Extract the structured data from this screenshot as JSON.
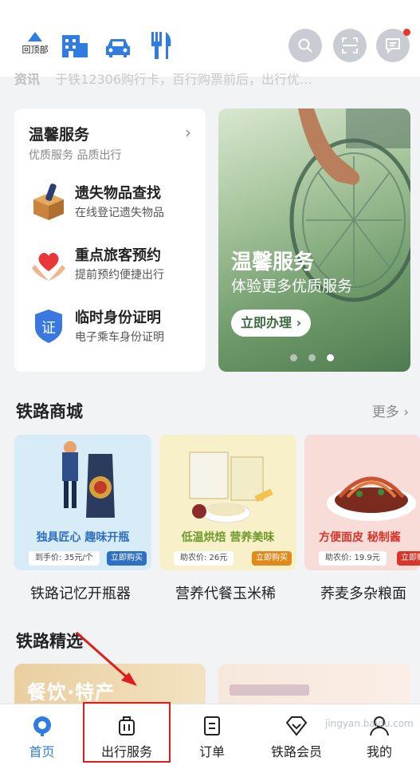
{
  "topbar": {
    "back_to_top": "回顶部",
    "icons": [
      "building-icon",
      "car-icon",
      "fork-knife-icon",
      "search-icon",
      "scan-icon",
      "message-icon"
    ],
    "accent": "#2f7de1"
  },
  "news": {
    "label": "资讯",
    "text": "于铁12306购行卡，百行购票前后，出行优…"
  },
  "warm_service": {
    "title": "温馨服务",
    "subtitle": "优质服务 品质出行",
    "items": [
      {
        "title": "遗失物品查找",
        "desc": "在线登记遗失物品",
        "icon": "box-icon"
      },
      {
        "title": "重点旅客预约",
        "desc": "提前预约便捷出行",
        "icon": "heart-hands-icon"
      },
      {
        "title": "临时身份证明",
        "desc": "电子乘车身份证明",
        "icon": "id-badge-icon"
      }
    ]
  },
  "banner": {
    "title": "温馨服务",
    "subtitle": "体验更多优质服务",
    "button": "立即办理",
    "active_dot": 3,
    "dot_count": 3
  },
  "mall": {
    "title": "铁路商城",
    "more": "更多",
    "products": [
      {
        "name": "铁路记忆开瓶器",
        "slogan": "独具匠心 趣味开瓶",
        "price": "到手价: 35元/个",
        "buy": "立即购买",
        "bg": "#d7ecf6",
        "slogan_color": "#2f6fc2",
        "buy_color": "#2f6fc2"
      },
      {
        "name": "营养代餐玉米稀",
        "slogan": "低温烘焙 营养美味",
        "price": "助农价: 26元",
        "buy": "立即购买",
        "bg": "#f7f0c8",
        "slogan_color": "#6d9a2a",
        "buy_color": "#e08a1e"
      },
      {
        "name": "荞麦多杂粮面",
        "slogan": "方便面皮 秘制酱",
        "price": "助农价: 19.9元",
        "buy": "立即购买",
        "bg": "#f8dcd8",
        "slogan_color": "#d8352a",
        "buy_color": "#d8352a"
      }
    ]
  },
  "picks": {
    "title": "铁路精选",
    "card1_text": "餐饮·特产"
  },
  "tabs": [
    {
      "label": "首页",
      "icon": "home-train-icon",
      "active": true
    },
    {
      "label": "出行服务",
      "icon": "luggage-icon",
      "active": false
    },
    {
      "label": "订单",
      "icon": "order-icon",
      "active": false
    },
    {
      "label": "铁路会员",
      "icon": "diamond-icon",
      "active": false
    },
    {
      "label": "我的",
      "icon": "person-icon",
      "active": false
    }
  ],
  "watermark": "jingyan.baidu.com"
}
